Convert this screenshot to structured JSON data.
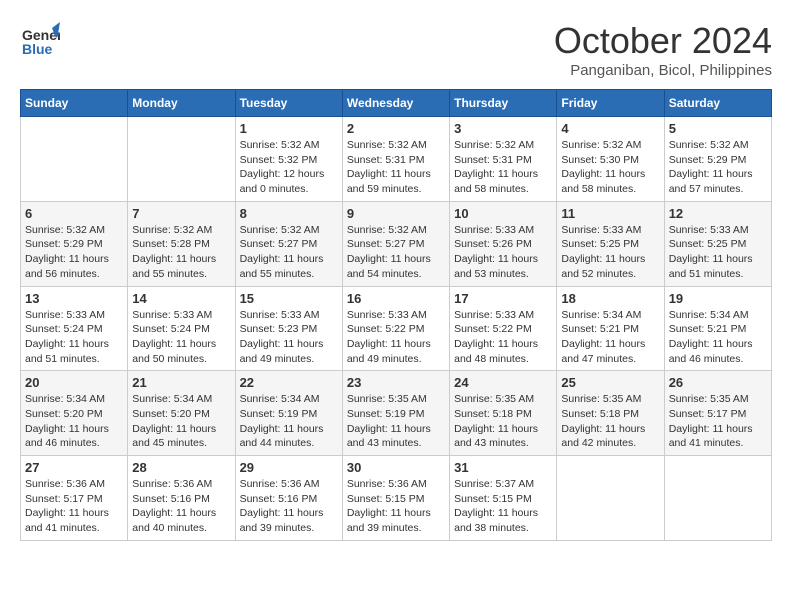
{
  "header": {
    "logo_line1": "General",
    "logo_line2": "Blue",
    "month": "October 2024",
    "location": "Panganiban, Bicol, Philippines"
  },
  "days_of_week": [
    "Sunday",
    "Monday",
    "Tuesday",
    "Wednesday",
    "Thursday",
    "Friday",
    "Saturday"
  ],
  "weeks": [
    [
      {
        "num": "",
        "info": ""
      },
      {
        "num": "",
        "info": ""
      },
      {
        "num": "1",
        "info": "Sunrise: 5:32 AM\nSunset: 5:32 PM\nDaylight: 12 hours\nand 0 minutes."
      },
      {
        "num": "2",
        "info": "Sunrise: 5:32 AM\nSunset: 5:31 PM\nDaylight: 11 hours\nand 59 minutes."
      },
      {
        "num": "3",
        "info": "Sunrise: 5:32 AM\nSunset: 5:31 PM\nDaylight: 11 hours\nand 58 minutes."
      },
      {
        "num": "4",
        "info": "Sunrise: 5:32 AM\nSunset: 5:30 PM\nDaylight: 11 hours\nand 58 minutes."
      },
      {
        "num": "5",
        "info": "Sunrise: 5:32 AM\nSunset: 5:29 PM\nDaylight: 11 hours\nand 57 minutes."
      }
    ],
    [
      {
        "num": "6",
        "info": "Sunrise: 5:32 AM\nSunset: 5:29 PM\nDaylight: 11 hours\nand 56 minutes."
      },
      {
        "num": "7",
        "info": "Sunrise: 5:32 AM\nSunset: 5:28 PM\nDaylight: 11 hours\nand 55 minutes."
      },
      {
        "num": "8",
        "info": "Sunrise: 5:32 AM\nSunset: 5:27 PM\nDaylight: 11 hours\nand 55 minutes."
      },
      {
        "num": "9",
        "info": "Sunrise: 5:32 AM\nSunset: 5:27 PM\nDaylight: 11 hours\nand 54 minutes."
      },
      {
        "num": "10",
        "info": "Sunrise: 5:33 AM\nSunset: 5:26 PM\nDaylight: 11 hours\nand 53 minutes."
      },
      {
        "num": "11",
        "info": "Sunrise: 5:33 AM\nSunset: 5:25 PM\nDaylight: 11 hours\nand 52 minutes."
      },
      {
        "num": "12",
        "info": "Sunrise: 5:33 AM\nSunset: 5:25 PM\nDaylight: 11 hours\nand 51 minutes."
      }
    ],
    [
      {
        "num": "13",
        "info": "Sunrise: 5:33 AM\nSunset: 5:24 PM\nDaylight: 11 hours\nand 51 minutes."
      },
      {
        "num": "14",
        "info": "Sunrise: 5:33 AM\nSunset: 5:24 PM\nDaylight: 11 hours\nand 50 minutes."
      },
      {
        "num": "15",
        "info": "Sunrise: 5:33 AM\nSunset: 5:23 PM\nDaylight: 11 hours\nand 49 minutes."
      },
      {
        "num": "16",
        "info": "Sunrise: 5:33 AM\nSunset: 5:22 PM\nDaylight: 11 hours\nand 49 minutes."
      },
      {
        "num": "17",
        "info": "Sunrise: 5:33 AM\nSunset: 5:22 PM\nDaylight: 11 hours\nand 48 minutes."
      },
      {
        "num": "18",
        "info": "Sunrise: 5:34 AM\nSunset: 5:21 PM\nDaylight: 11 hours\nand 47 minutes."
      },
      {
        "num": "19",
        "info": "Sunrise: 5:34 AM\nSunset: 5:21 PM\nDaylight: 11 hours\nand 46 minutes."
      }
    ],
    [
      {
        "num": "20",
        "info": "Sunrise: 5:34 AM\nSunset: 5:20 PM\nDaylight: 11 hours\nand 46 minutes."
      },
      {
        "num": "21",
        "info": "Sunrise: 5:34 AM\nSunset: 5:20 PM\nDaylight: 11 hours\nand 45 minutes."
      },
      {
        "num": "22",
        "info": "Sunrise: 5:34 AM\nSunset: 5:19 PM\nDaylight: 11 hours\nand 44 minutes."
      },
      {
        "num": "23",
        "info": "Sunrise: 5:35 AM\nSunset: 5:19 PM\nDaylight: 11 hours\nand 43 minutes."
      },
      {
        "num": "24",
        "info": "Sunrise: 5:35 AM\nSunset: 5:18 PM\nDaylight: 11 hours\nand 43 minutes."
      },
      {
        "num": "25",
        "info": "Sunrise: 5:35 AM\nSunset: 5:18 PM\nDaylight: 11 hours\nand 42 minutes."
      },
      {
        "num": "26",
        "info": "Sunrise: 5:35 AM\nSunset: 5:17 PM\nDaylight: 11 hours\nand 41 minutes."
      }
    ],
    [
      {
        "num": "27",
        "info": "Sunrise: 5:36 AM\nSunset: 5:17 PM\nDaylight: 11 hours\nand 41 minutes."
      },
      {
        "num": "28",
        "info": "Sunrise: 5:36 AM\nSunset: 5:16 PM\nDaylight: 11 hours\nand 40 minutes."
      },
      {
        "num": "29",
        "info": "Sunrise: 5:36 AM\nSunset: 5:16 PM\nDaylight: 11 hours\nand 39 minutes."
      },
      {
        "num": "30",
        "info": "Sunrise: 5:36 AM\nSunset: 5:15 PM\nDaylight: 11 hours\nand 39 minutes."
      },
      {
        "num": "31",
        "info": "Sunrise: 5:37 AM\nSunset: 5:15 PM\nDaylight: 11 hours\nand 38 minutes."
      },
      {
        "num": "",
        "info": ""
      },
      {
        "num": "",
        "info": ""
      }
    ]
  ]
}
